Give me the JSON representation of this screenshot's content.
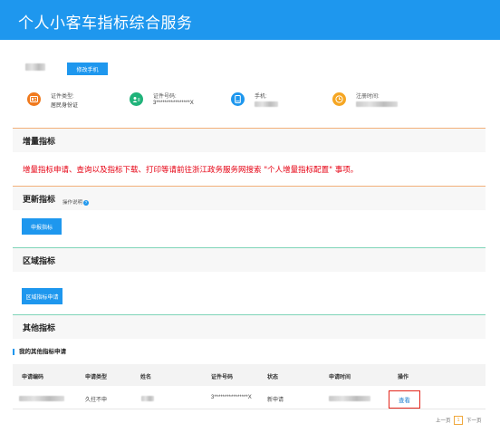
{
  "header": {
    "title": "个人小客车指标综合服务"
  },
  "user": {
    "edit_phone_label": "修改手机"
  },
  "info": {
    "id_type": {
      "label": "证件类型:",
      "value": "居民身份证",
      "icon": "id-card-icon",
      "color": "#f07a1e"
    },
    "id_number": {
      "label": "证件号码:",
      "value": "3****************X",
      "icon": "person-card-icon",
      "color": "#20b37a"
    },
    "phone": {
      "label": "手机:",
      "icon": "phone-icon",
      "color": "#1e97ee"
    },
    "register_time": {
      "label": "注册时间:",
      "icon": "clock-icon",
      "color": "#f5a623"
    }
  },
  "sections": {
    "increment": {
      "title": "增量指标",
      "notice": "增量指标申请、查询以及指标下载、打印等请前往浙江政务服务网搜索 \"个人增量指标配置\" 事项。"
    },
    "update": {
      "title": "更新指标",
      "guide": "操作说明",
      "button": "申报指标"
    },
    "regional": {
      "title": "区域指标",
      "button": "区域指标申请"
    },
    "other": {
      "title": "其他指标",
      "subtitle": "我的其他指标申请"
    }
  },
  "table": {
    "headers": [
      "申请编码",
      "申请类型",
      "姓名",
      "证件号码",
      "状态",
      "申请时间",
      "操作"
    ],
    "row": {
      "type": "久拄不申",
      "id_number": "3****************X",
      "status": "新申请",
      "action": "查看"
    }
  },
  "pagination": {
    "prev": "上一页",
    "current": "1",
    "next": "下一页"
  }
}
